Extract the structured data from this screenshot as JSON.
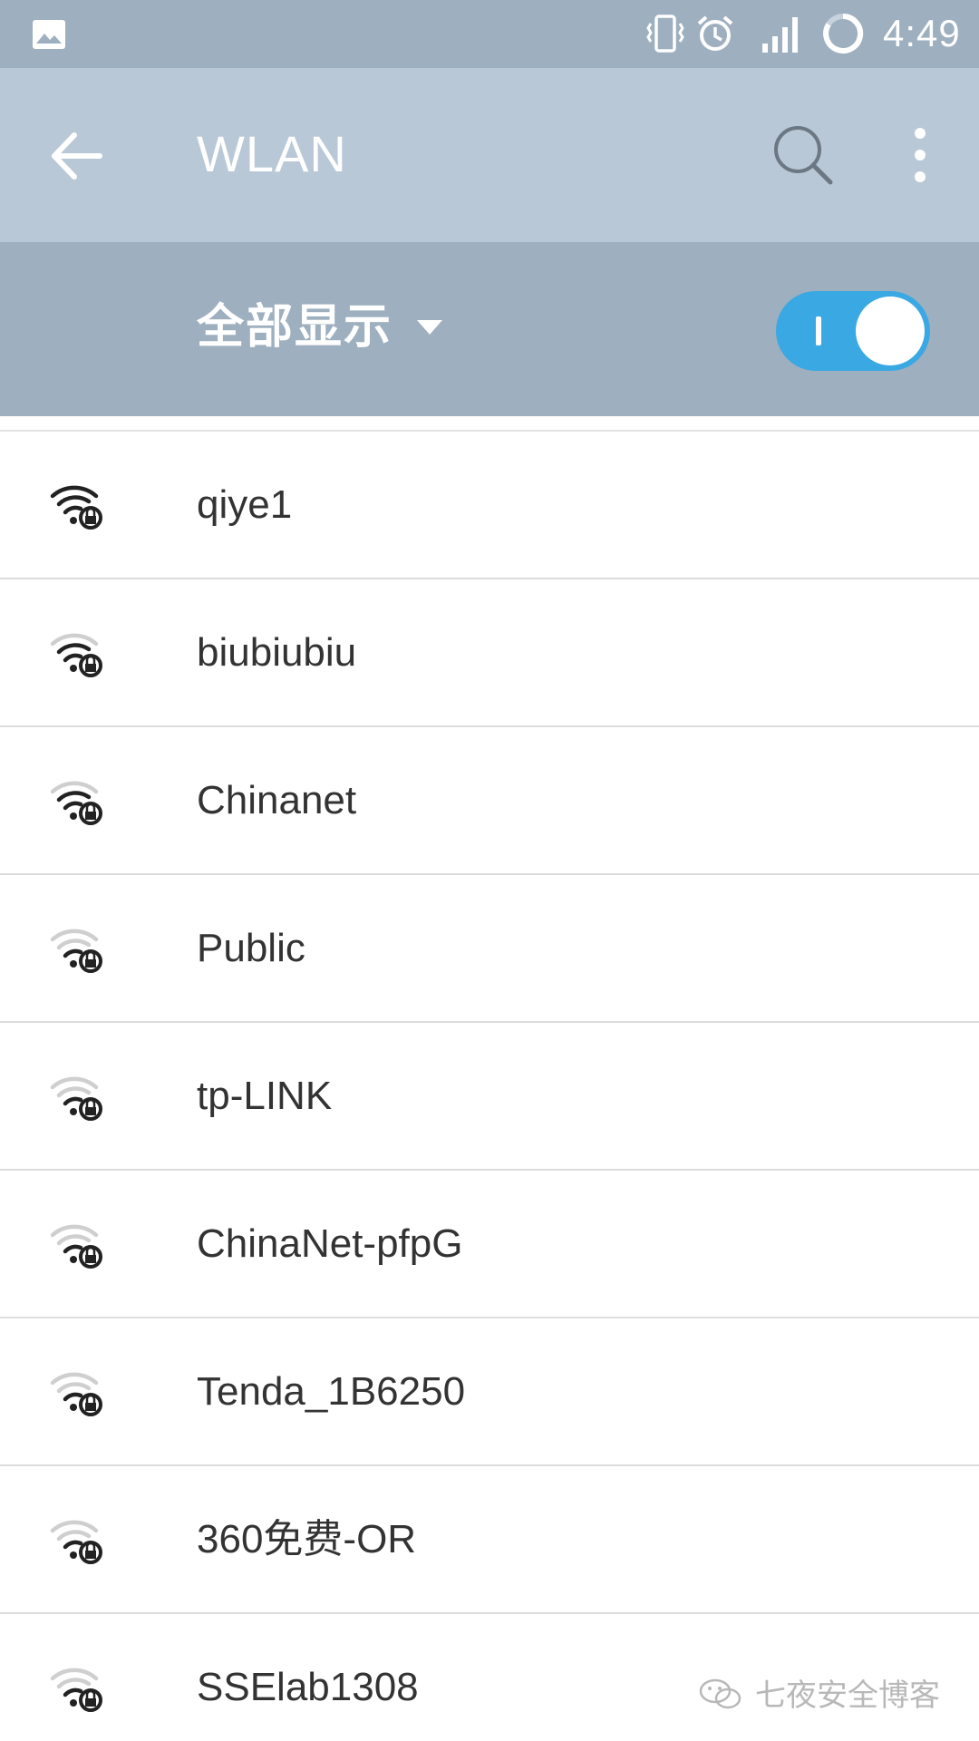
{
  "status_bar": {
    "time": "4:49",
    "icons": [
      "gallery-icon",
      "vibrate-icon",
      "alarm-icon",
      "signal-icon",
      "battery-icon"
    ]
  },
  "app_bar": {
    "title": "WLAN",
    "back_icon": "arrow-left-icon",
    "search_icon": "search-icon",
    "more_icon": "more-vert-icon"
  },
  "filter": {
    "label": "全部显示",
    "dropdown_icon": "triangle-down-icon"
  },
  "wlan_toggle": {
    "state": "on",
    "color": "#3aa8e3"
  },
  "networks": [
    {
      "ssid": "qiye1",
      "signal_bars": 3,
      "secured": true
    },
    {
      "ssid": "biubiubiu",
      "signal_bars": 2,
      "secured": true
    },
    {
      "ssid": "Chinanet",
      "signal_bars": 2,
      "secured": true
    },
    {
      "ssid": "Public",
      "signal_bars": 1,
      "secured": true
    },
    {
      "ssid": "tp-LINK",
      "signal_bars": 1,
      "secured": true
    },
    {
      "ssid": "ChinaNet-pfpG",
      "signal_bars": 1,
      "secured": true
    },
    {
      "ssid": "Tenda_1B6250",
      "signal_bars": 1,
      "secured": true
    },
    {
      "ssid": "360免费-OR",
      "signal_bars": 1,
      "secured": true
    },
    {
      "ssid": "SSElab1308",
      "signal_bars": 1,
      "secured": true
    }
  ],
  "watermark": {
    "text": "七夜安全博客",
    "icon": "wechat-icon"
  },
  "colors": {
    "status_bar": "#9eafbf",
    "app_bar": "#b9c8d6",
    "filter_bar": "#9eafbf",
    "accent": "#3aa8e3"
  }
}
